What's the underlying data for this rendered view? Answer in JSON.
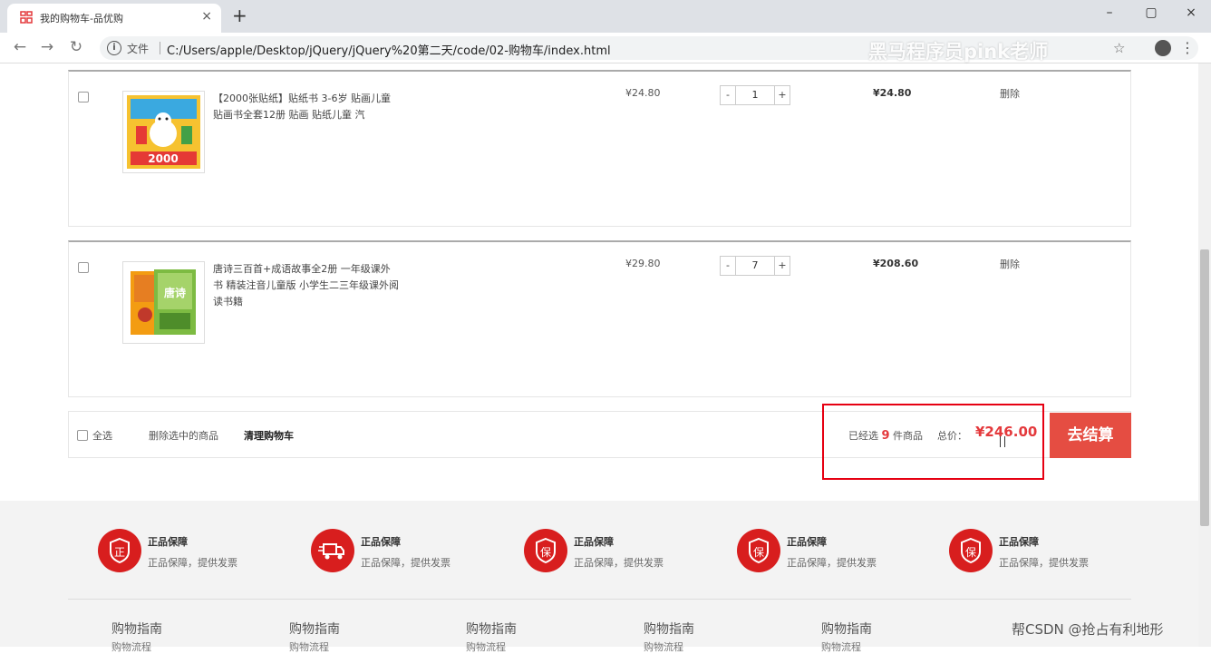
{
  "browser": {
    "tab_title": "我的购物车-品优购",
    "tab_close": "×",
    "new_tab": "+",
    "file_label": "文件",
    "url": "C:/Users/apple/Desktop/jQuery/jQuery%20第二天/code/02-购物车/index.html",
    "watermark": "黑马程序员pink老师",
    "window_controls": {
      "minimize": "–",
      "maximize": "▢",
      "close": "×"
    },
    "nav": {
      "back": "←",
      "forward": "→",
      "reload": "↻"
    },
    "icons": {
      "favicon": "shop-icon",
      "star": "star-icon",
      "profile": "profile-icon",
      "menu": "more-icon"
    },
    "star_glyph": "☆",
    "menu_glyph": "⋮"
  },
  "cart": {
    "items": [
      {
        "name": "【2000张贴纸】贴纸书 3-6岁 贴画儿童 贴画书全套12册 贴画 贴纸儿童 汽",
        "price": "¥24.80",
        "quantity": "1",
        "subtotal": "¥24.80",
        "delete": "删除",
        "image_text": "2000"
      },
      {
        "name": "唐诗三百首+成语故事全2册 一年级课外书 精装注音儿童版 小学生二三年级课外阅读书籍",
        "price": "¥29.80",
        "quantity": "7",
        "subtotal": "¥208.60",
        "delete": "删除",
        "image_text": "唐诗"
      }
    ],
    "qty_minus": "-",
    "qty_plus": "+",
    "actions": {
      "select_all": "全选",
      "remove_selected": "删除选中的商品",
      "clear_cart": "清理购物车",
      "selected_prefix": "已经选",
      "selected_count": "9",
      "selected_suffix": "件商品",
      "total_label": "总价：",
      "total_price": "¥246.00",
      "checkout": "去结算"
    },
    "colors": {
      "accent": "#e4393c",
      "checkout_bg": "#e54d42",
      "highlight": "#e60012"
    }
  },
  "footer": {
    "services": [
      {
        "icon": "genuine-icon",
        "glyph": "正",
        "title": "正品保障",
        "desc": "正品保障，提供发票"
      },
      {
        "icon": "delivery-truck-icon",
        "glyph": "",
        "title": "正品保障",
        "desc": "正品保障，提供发票"
      },
      {
        "icon": "shield-icon",
        "glyph": "保",
        "title": "正品保障",
        "desc": "正品保障，提供发票"
      },
      {
        "icon": "shield-icon",
        "glyph": "保",
        "title": "正品保障",
        "desc": "正品保障，提供发票"
      },
      {
        "icon": "shield-icon",
        "glyph": "保",
        "title": "正品保障",
        "desc": "正品保障，提供发票"
      }
    ],
    "guides": [
      "购物指南",
      "购物指南",
      "购物指南",
      "购物指南",
      "购物指南"
    ],
    "guide_sub": "购物流程",
    "csdn": "帮CSDN @抢占有利地形"
  }
}
